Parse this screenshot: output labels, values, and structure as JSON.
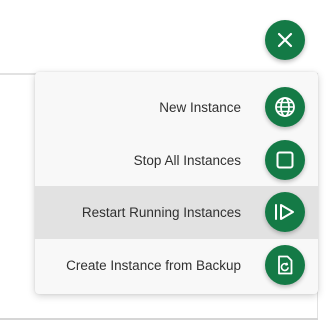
{
  "close_button": {
    "icon": "close-icon"
  },
  "menu": {
    "items": [
      {
        "label": "New Instance",
        "icon": "globe-icon",
        "highlighted": false
      },
      {
        "label": "Stop All Instances",
        "icon": "stop-square-icon",
        "highlighted": false
      },
      {
        "label": "Restart Running Instances",
        "icon": "restart-play-icon",
        "highlighted": true
      },
      {
        "label": "Create Instance from Backup",
        "icon": "backup-restore-icon",
        "highlighted": false
      }
    ]
  },
  "colors": {
    "accent": "#147a46",
    "menu_background": "#f8f8f8",
    "highlight_background": "#e2e2e2",
    "text": "#303030"
  }
}
